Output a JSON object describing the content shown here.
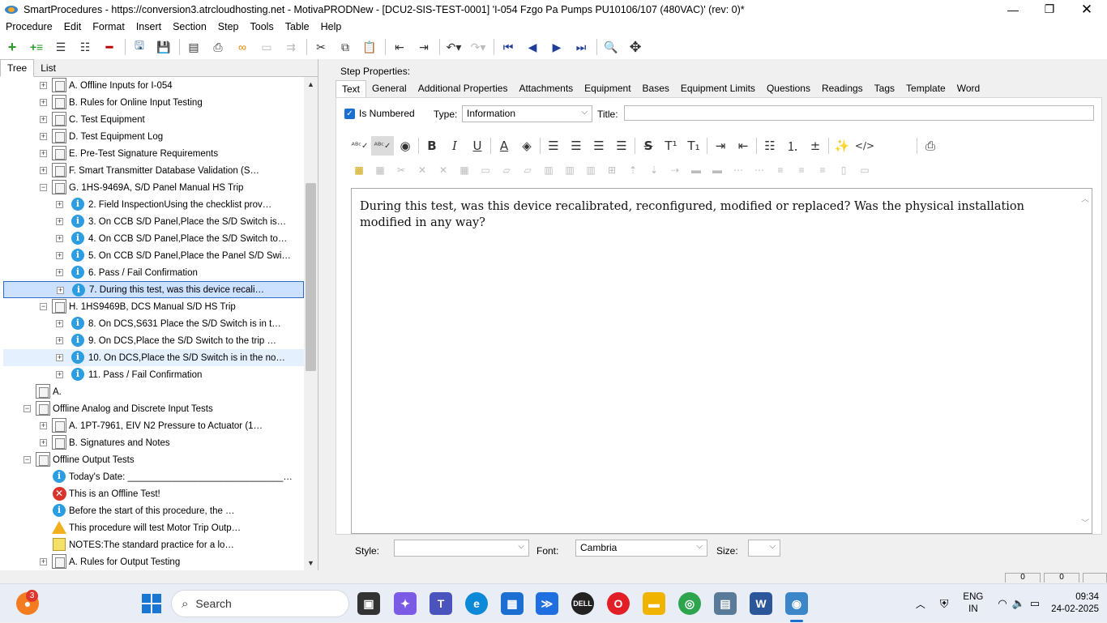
{
  "window": {
    "title": "SmartProcedures - https://conversion3.atrcloudhosting.net - MotivaPRODNew - [DCU2-SIS-TEST-0001] 'I-054 Fzgo Pa Pumps PU10106/107 (480VAC)' (rev: 0)*"
  },
  "menu": [
    "Procedure",
    "Edit",
    "Format",
    "Insert",
    "Section",
    "Step",
    "Tools",
    "Table",
    "Help"
  ],
  "left_tabs": [
    "Tree",
    "List"
  ],
  "tree": [
    {
      "label": "A. Offline Inputs for I-054",
      "icon": "doc-icon",
      "exp": "+",
      "level": 2
    },
    {
      "label": "B. Rules for Online Input Testing",
      "icon": "doc-icon",
      "exp": "+",
      "level": 2
    },
    {
      "label": "C. Test Equipment",
      "icon": "doc-icon",
      "exp": "+",
      "level": 2
    },
    {
      "label": "D. Test Equipment Log",
      "icon": "doc-icon",
      "exp": "+",
      "level": 2
    },
    {
      "label": "E. Pre-Test Signature Requirements",
      "icon": "doc-icon",
      "exp": "+",
      "level": 2
    },
    {
      "label": "F. Smart Transmitter Database Validation (S…",
      "icon": "doc-icon",
      "exp": "+",
      "level": 2
    },
    {
      "label": "G. 1HS-9469A, S/D Panel Manual HS Trip",
      "icon": "doc-icon",
      "exp": "−",
      "level": 2
    },
    {
      "label": "2. Field InspectionUsing the checklist prov…",
      "icon": "info-icon",
      "exp": "+",
      "level": 3
    },
    {
      "label": "3. On CCB S/D Panel,Place the S/D Switch is…",
      "icon": "info-icon",
      "exp": "+",
      "level": 3
    },
    {
      "label": "4. On CCB S/D Panel,Place the S/D Switch to…",
      "icon": "info-icon",
      "exp": "+",
      "level": 3
    },
    {
      "label": "5. On CCB S/D Panel,Place the Panel S/D Swi…",
      "icon": "info-icon",
      "exp": "+",
      "level": 3
    },
    {
      "label": "6. Pass / Fail Confirmation",
      "icon": "info-icon",
      "exp": "+",
      "level": 3
    },
    {
      "label": "7. During this test, was this device recali…",
      "icon": "info-icon",
      "exp": "+",
      "level": 3,
      "state": "selected"
    },
    {
      "label": "H. 1HS9469B, DCS Manual S/D HS Trip",
      "icon": "doc-icon",
      "exp": "−",
      "level": 2
    },
    {
      "label": "8. On DCS,S631 Place the S/D Switch is in t…",
      "icon": "info-icon",
      "exp": "+",
      "level": 3
    },
    {
      "label": "9. On DCS,Place the S/D Switch to the trip …",
      "icon": "info-icon",
      "exp": "+",
      "level": 3
    },
    {
      "label": "10. On DCS,Place the S/D Switch is in the no…",
      "icon": "info-icon",
      "exp": "+",
      "level": 3,
      "state": "hover"
    },
    {
      "label": "11. Pass / Fail Confirmation",
      "icon": "info-icon",
      "exp": "+",
      "level": 3
    },
    {
      "label": "A.",
      "icon": "doc-icon",
      "exp": "",
      "level": 1
    },
    {
      "label": "Offline Analog and Discrete Input Tests",
      "icon": "doc-icon",
      "exp": "−",
      "level": 1
    },
    {
      "label": "A. 1PT-7961, EIV N2 Pressure to Actuator (1…",
      "icon": "doc-icon",
      "exp": "+",
      "level": 2
    },
    {
      "label": "B. Signatures and Notes",
      "icon": "doc-icon",
      "exp": "+",
      "level": 2
    },
    {
      "label": "Offline Output Tests",
      "icon": "doc-icon",
      "exp": "−",
      "level": 1
    },
    {
      "label": "Today's Date: ______________________________…",
      "icon": "info-icon",
      "exp": "",
      "level": 2
    },
    {
      "label": "This is an Offline Test!",
      "icon": "error-icon",
      "exp": "",
      "level": 2
    },
    {
      "label": "Before the start of this procedure, the …",
      "icon": "info-icon",
      "exp": "",
      "level": 2
    },
    {
      "label": "This procedure will test Motor Trip Outp…",
      "icon": "warning-icon",
      "exp": "",
      "level": 2
    },
    {
      "label": "NOTES:The standard practice for a lo…",
      "icon": "note-icon",
      "exp": "",
      "level": 2
    },
    {
      "label": "A. Rules for Output Testing",
      "icon": "doc-icon",
      "exp": "+",
      "level": 2
    }
  ],
  "props": {
    "header": "Step Properties:",
    "tabs": [
      "Text",
      "General",
      "Additional Properties",
      "Attachments",
      "Equipment",
      "Bases",
      "Equipment Limits",
      "Questions",
      "Readings",
      "Tags",
      "Template",
      "Word"
    ],
    "is_numbered_label": "Is Numbered",
    "type_label": "Type:",
    "type_value": "Information",
    "title_label": "Title:",
    "title_value": "",
    "editor_text": "During this test, was this device recalibrated, reconfigured, modified or replaced? Was the physical installation modified in any way?",
    "style_label": "Style:",
    "style_value": "",
    "font_label": "Font:",
    "font_value": "Cambria",
    "size_label": "Size:",
    "size_value": ""
  },
  "status": {
    "pane1": "0",
    "pane2": "0"
  },
  "taskbar": {
    "search_placeholder": "Search",
    "notif_count": "3",
    "lang": "ENG",
    "region": "IN",
    "time": "09:34",
    "date": "24-02-2025"
  }
}
